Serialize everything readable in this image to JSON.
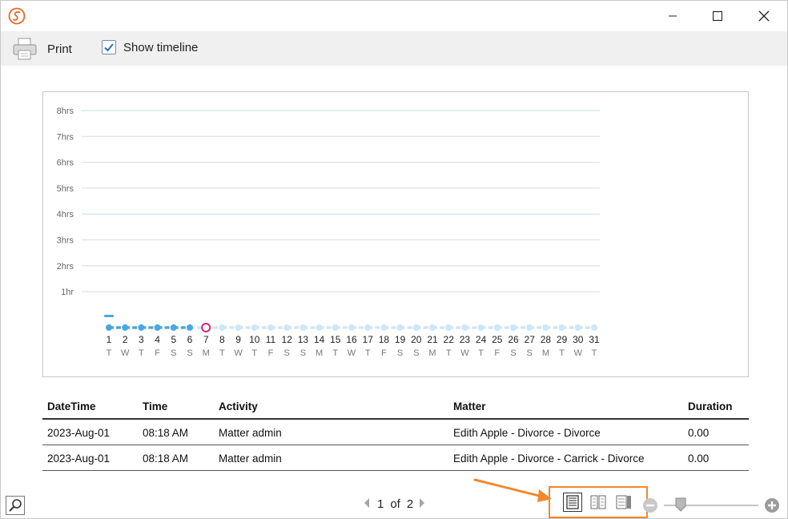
{
  "window": {
    "logo_icon": "app-logo-icon",
    "buttons": [
      "minimize",
      "maximize",
      "close"
    ]
  },
  "toolbar": {
    "print_label": "Print",
    "show_timeline_label": "Show timeline",
    "show_timeline_checked": true
  },
  "chart_data": {
    "type": "line",
    "y_ticks": [
      "8hrs",
      "7hrs",
      "6hrs",
      "5hrs",
      "4hrs",
      "3hrs",
      "2hrs",
      "1hr"
    ],
    "ylim": [
      0,
      8
    ],
    "days": [
      "1",
      "2",
      "3",
      "4",
      "5",
      "6",
      "7",
      "8",
      "9",
      "10",
      "11",
      "12",
      "13",
      "14",
      "15",
      "16",
      "17",
      "18",
      "19",
      "20",
      "21",
      "22",
      "23",
      "24",
      "25",
      "26",
      "27",
      "28",
      "29",
      "30",
      "31"
    ],
    "weekdays": [
      "T",
      "W",
      "T",
      "F",
      "S",
      "S",
      "M",
      "T",
      "W",
      "T",
      "F",
      "S",
      "S",
      "M",
      "T",
      "W",
      "T",
      "F",
      "S",
      "S",
      "M",
      "T",
      "W",
      "T",
      "F",
      "S",
      "S",
      "M",
      "T",
      "W",
      "T"
    ],
    "active_days": [
      "1",
      "2",
      "3",
      "4",
      "5",
      "6"
    ],
    "current_day": "7",
    "values": [
      0,
      0,
      0,
      0,
      0,
      0,
      0,
      0,
      0,
      0,
      0,
      0,
      0,
      0,
      0,
      0,
      0,
      0,
      0,
      0,
      0,
      0,
      0,
      0,
      0,
      0,
      0,
      0,
      0,
      0,
      0
    ],
    "highlighted_gridlines": [
      "8hrs",
      "4hrs"
    ],
    "colors": {
      "active": "#4aa8e0",
      "inactive": "#cfe6f5",
      "current": "#d6246e",
      "grid": "#dcdcdc",
      "grid_highlight": "#bfe0f2"
    }
  },
  "table": {
    "columns": [
      "DateTime",
      "Time",
      "Activity",
      "Matter",
      "Duration"
    ],
    "rows": [
      [
        "2023-Aug-01",
        "08:18 AM",
        "Matter admin",
        "Edith Apple - Divorce - Divorce",
        "0.00"
      ],
      [
        "2023-Aug-01",
        "08:18 AM",
        "Matter admin",
        "Edith Apple - Divorce - Carrick - Divorce",
        "0.00"
      ]
    ]
  },
  "pager": {
    "current": "1",
    "of_label": "of",
    "total": "2"
  },
  "view_modes": [
    "single-page",
    "two-pages",
    "multi-page"
  ],
  "zoom": {
    "level_fraction": 0.18
  },
  "accent": "#ef8a2e"
}
